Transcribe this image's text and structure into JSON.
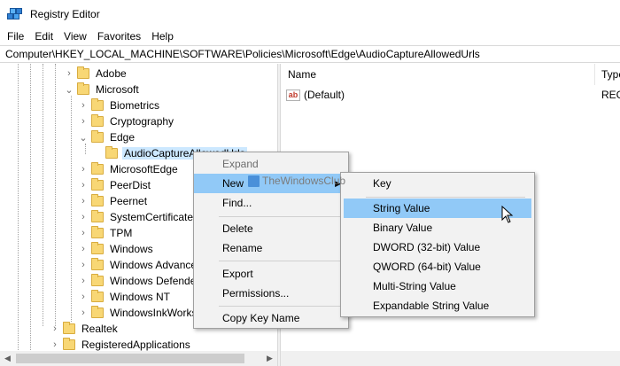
{
  "window": {
    "title": "Registry Editor"
  },
  "menubar": [
    "File",
    "Edit",
    "View",
    "Favorites",
    "Help"
  ],
  "address": "Computer\\HKEY_LOCAL_MACHINE\\SOFTWARE\\Policies\\Microsoft\\Edge\\AudioCaptureAllowedUrls",
  "tree": {
    "items": [
      {
        "label": "Adobe",
        "expander": "›"
      },
      {
        "label": "Microsoft",
        "expander": "⌄"
      },
      {
        "label": "Biometrics",
        "expander": "›"
      },
      {
        "label": "Cryptography",
        "expander": "›"
      },
      {
        "label": "Edge",
        "expander": "⌄"
      },
      {
        "label": "AudioCaptureAllowedUrls",
        "expander": ""
      },
      {
        "label": "MicrosoftEdge",
        "expander": "›"
      },
      {
        "label": "PeerDist",
        "expander": "›"
      },
      {
        "label": "Peernet",
        "expander": "›"
      },
      {
        "label": "SystemCertificates",
        "expander": "›"
      },
      {
        "label": "TPM",
        "expander": "›"
      },
      {
        "label": "Windows",
        "expander": "›"
      },
      {
        "label": "Windows Advanced Threat Protection",
        "expander": "›"
      },
      {
        "label": "Windows Defender",
        "expander": "›"
      },
      {
        "label": "Windows NT",
        "expander": "›"
      },
      {
        "label": "WindowsInkWorkspace",
        "expander": "›"
      },
      {
        "label": "Realtek",
        "expander": "›"
      },
      {
        "label": "RegisteredApplications",
        "expander": "›"
      }
    ]
  },
  "values": {
    "columns": {
      "name": "Name",
      "type": "Type"
    },
    "rows": [
      {
        "name": "(Default)",
        "type": "REG_SZ",
        "icon": "ab"
      }
    ]
  },
  "context_menu": {
    "items": [
      {
        "label": "Expand"
      },
      {
        "label": "New"
      },
      {
        "label": "Find..."
      },
      {
        "label": "Delete"
      },
      {
        "label": "Rename"
      },
      {
        "label": "Export"
      },
      {
        "label": "Permissions..."
      },
      {
        "label": "Copy Key Name"
      }
    ]
  },
  "submenu": {
    "items": [
      {
        "label": "Key"
      },
      {
        "label": "String Value"
      },
      {
        "label": "Binary Value"
      },
      {
        "label": "DWORD (32-bit) Value"
      },
      {
        "label": "QWORD (64-bit) Value"
      },
      {
        "label": "Multi-String Value"
      },
      {
        "label": "Expandable String Value"
      }
    ]
  },
  "watermark": "TheWindowsClub",
  "colors": {
    "highlight": "#91c9f7",
    "selection": "#cce8ff",
    "folder": "#f8d775"
  }
}
